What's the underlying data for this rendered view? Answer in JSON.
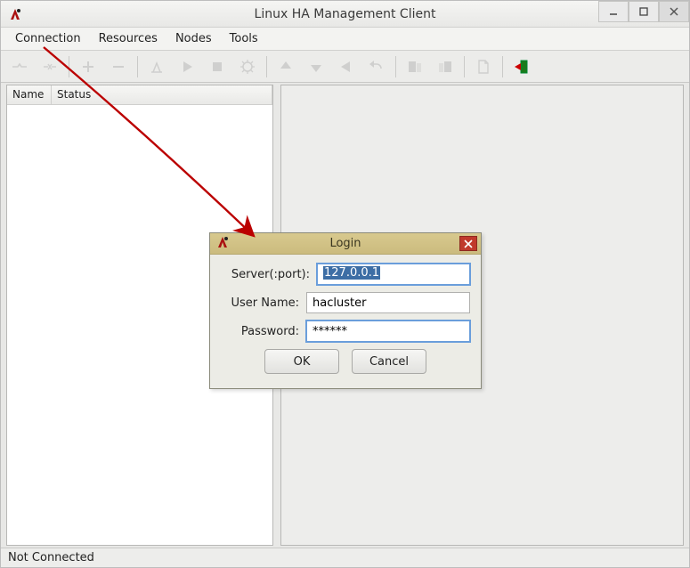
{
  "window": {
    "title": "Linux HA Management Client"
  },
  "menubar": {
    "items": [
      "Connection",
      "Resources",
      "Nodes",
      "Tools"
    ]
  },
  "toolbar": {
    "icons": [
      "connect-icon",
      "disconnect-icon",
      "sep",
      "add-icon",
      "remove-icon",
      "sep",
      "cleanup-icon",
      "start-icon",
      "stop-icon",
      "manage-icon",
      "sep",
      "up-icon",
      "down-icon",
      "back-icon",
      "undo-icon",
      "sep",
      "shadow1-icon",
      "shadow2-icon",
      "sep",
      "doc-icon",
      "sep",
      "exit-icon"
    ]
  },
  "tree": {
    "columns": [
      "Name",
      "Status"
    ]
  },
  "statusbar": {
    "text": "Not Connected"
  },
  "dialog": {
    "title": "Login",
    "server_label": "Server(:port):",
    "server_value": "127.0.0.1",
    "user_label": "User Name:",
    "user_value": "hacluster",
    "password_label": "Password:",
    "password_value": "******",
    "ok_label": "OK",
    "cancel_label": "Cancel"
  }
}
